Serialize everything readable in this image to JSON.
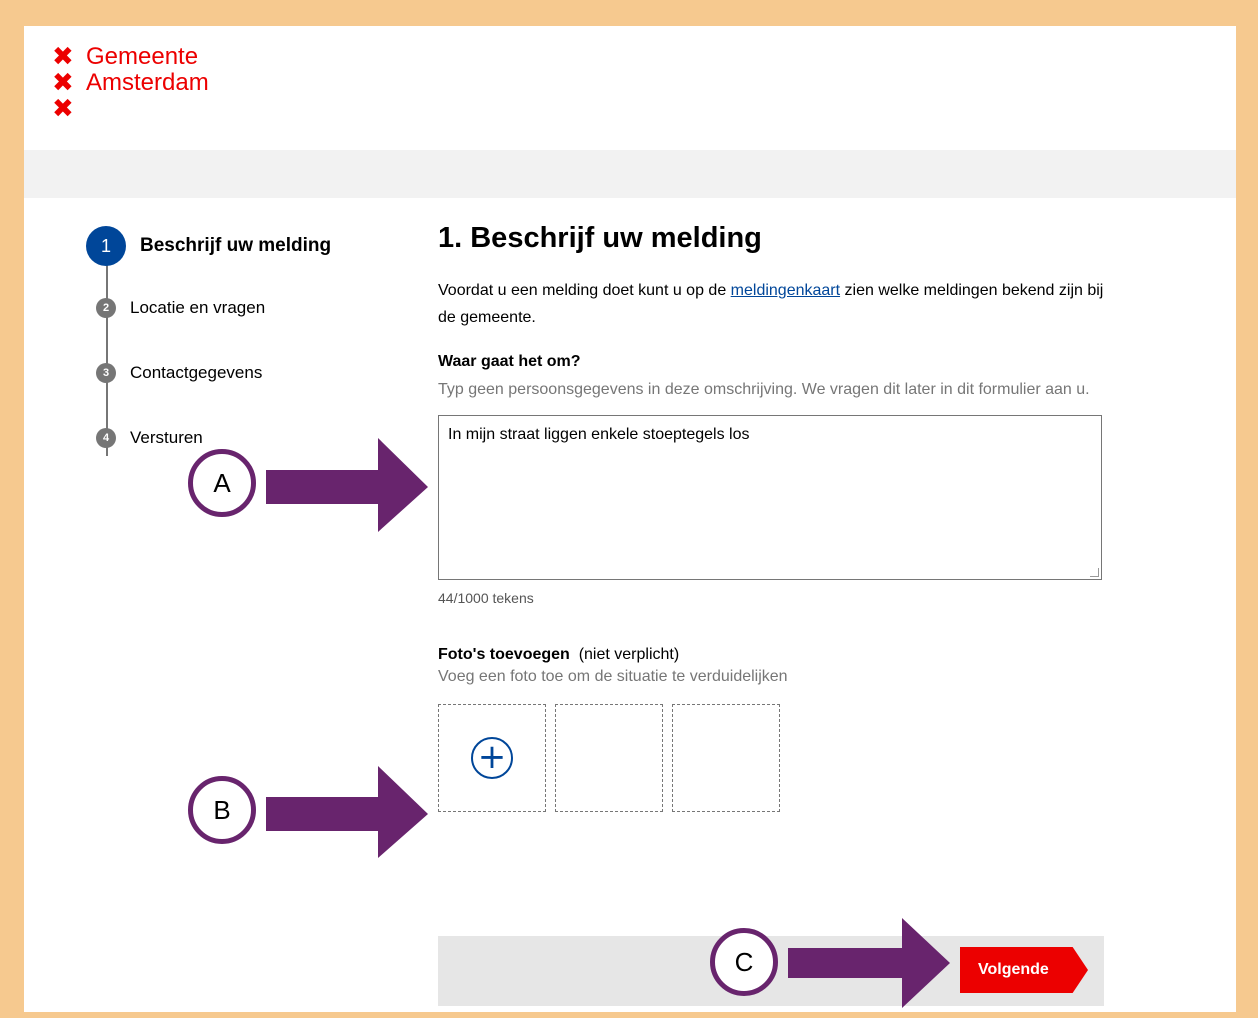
{
  "header": {
    "logo_lines": [
      "Gemeente",
      "Amsterdam",
      ""
    ],
    "logo_symbol": "✖"
  },
  "stepper": {
    "steps": [
      {
        "number": "1",
        "label": "Beschrijf uw melding",
        "active": true
      },
      {
        "number": "2",
        "label": "Locatie en vragen",
        "active": false
      },
      {
        "number": "3",
        "label": "Contactgegevens",
        "active": false
      },
      {
        "number": "4",
        "label": "Versturen",
        "active": false
      }
    ]
  },
  "main": {
    "title": "1. Beschrijf uw melding",
    "intro_before": "Voordat u een melding doet kunt u op de ",
    "intro_link": "meldingenkaart",
    "intro_after": " zien welke meldingen bekend zijn bij de gemeente.",
    "description": {
      "label": "Waar gaat het om?",
      "hint": "Typ geen persoonsgegevens in deze omschrijving. We vragen dit later in dit formulier aan u.",
      "value": "In mijn straat liggen enkele stoeptegels los",
      "counter": "44/1000 tekens"
    },
    "photos": {
      "label": "Foto's toevoegen",
      "optional": "(niet verplicht)",
      "hint": "Voeg een foto toe om de situatie te verduidelijken"
    }
  },
  "footer": {
    "next_label": "Volgende"
  },
  "annotations": {
    "a": "A",
    "b": "B",
    "c": "C",
    "color": "#68246d"
  },
  "colors": {
    "brand_red": "#ec0000",
    "brand_blue": "#004699",
    "outer_frame": "#f6c98f"
  }
}
